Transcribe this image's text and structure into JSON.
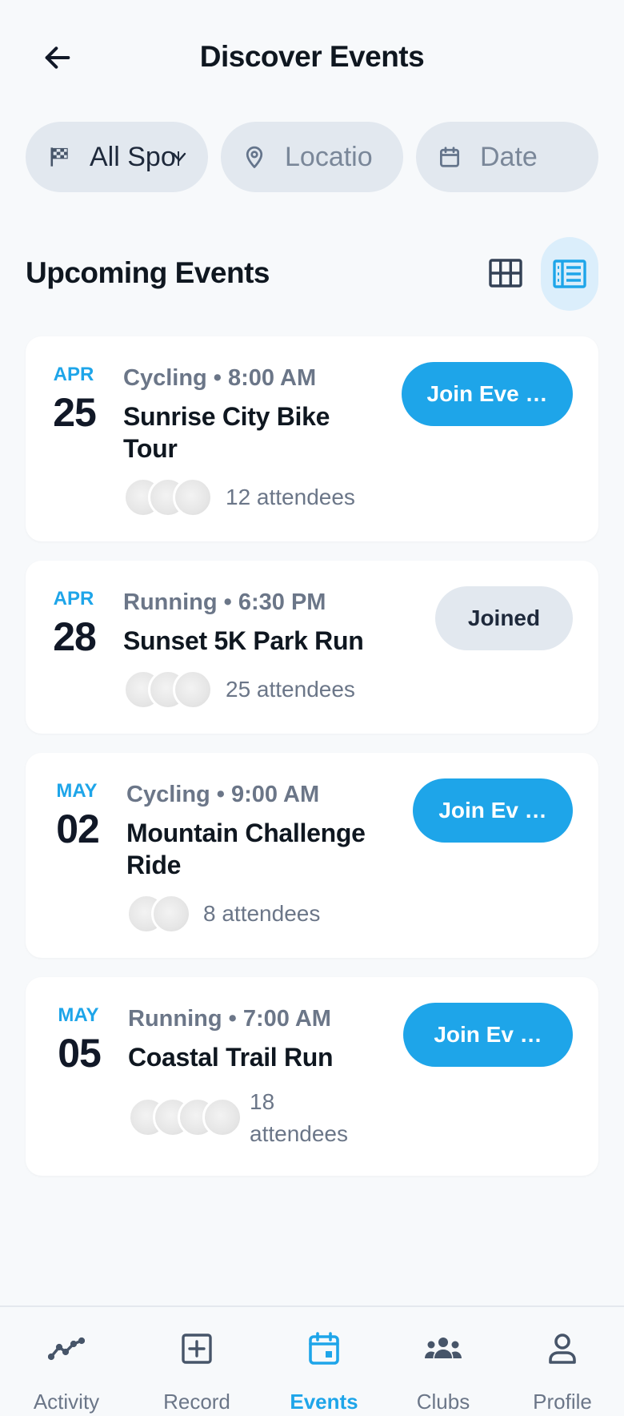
{
  "header": {
    "title": "Discover Events"
  },
  "filters": {
    "sport": "All Spor",
    "location": "Locatio",
    "date": "Date"
  },
  "section": {
    "title": "Upcoming Events"
  },
  "events": [
    {
      "month": "APR",
      "day": "25",
      "meta": "Cycling • 8:00 AM",
      "title": "Sunrise City Bike Tour",
      "attendees": "12 attendees",
      "button": "Join Eve …",
      "status": "join"
    },
    {
      "month": "APR",
      "day": "28",
      "meta": "Running • 6:30 PM",
      "title": "Sunset 5K Park Run",
      "attendees": "25 attendees",
      "button": "Joined",
      "status": "joined"
    },
    {
      "month": "MAY",
      "day": "02",
      "meta": "Cycling • 9:00 AM",
      "title": "Mountain Challenge Ride",
      "attendees": "8 attendees",
      "button": "Join Ev …",
      "status": "join"
    },
    {
      "month": "MAY",
      "day": "05",
      "meta": "Running • 7:00 AM",
      "title": "Coastal Trail Run",
      "attendees": "18 attendees",
      "button": "Join Ev …",
      "status": "join"
    }
  ],
  "nav": [
    {
      "label": "Activity",
      "icon": "activity-icon"
    },
    {
      "label": "Record",
      "icon": "plus-square-icon"
    },
    {
      "label": "Events",
      "icon": "calendar-icon",
      "active": true
    },
    {
      "label": "Clubs",
      "icon": "group-icon"
    },
    {
      "label": "Profile",
      "icon": "person-icon"
    }
  ],
  "colors": {
    "accent": "#1ea5e9",
    "chip": "#e2e8ef",
    "background": "#f7f9fb"
  }
}
